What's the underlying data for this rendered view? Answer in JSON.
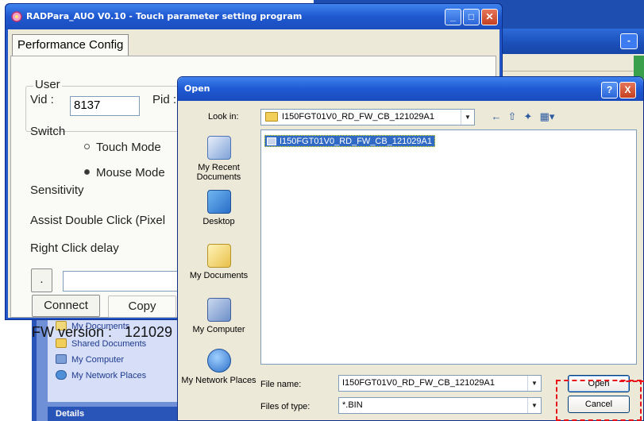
{
  "radpara": {
    "title": "RADPara_AUO V0.10 - Touch parameter setting program",
    "tab": "Performance Config",
    "user_group_label": "User",
    "vid_label": "Vid :",
    "vid_value": "8137",
    "pid_label": "Pid :",
    "switch_label": "Switch",
    "touch_mode": "Touch Mode",
    "mouse_mode": "Mouse Mode",
    "sensitivity_label": "Sensitivity",
    "assist_double_click_label": "Assist Double Click (Pixel",
    "right_click_delay_label": "Right Click delay",
    "small_button": ".",
    "connect_button": "Connect",
    "copy_button": "Copy",
    "fw_version_label": "FW version :",
    "fw_version_value": "121029"
  },
  "background_explorer": {
    "task_items": [
      "My Documents",
      "Shared Documents",
      "My Computer",
      "My Network Places"
    ],
    "details_header": "Details"
  },
  "open_dialog": {
    "title": "Open",
    "help_button": "?",
    "close_button": "X",
    "look_in_label": "Look in:",
    "look_in_value": "I150FGT01V0_RD_FW_CB_121029A1",
    "places": [
      "My Recent Documents",
      "Desktop",
      "My Documents",
      "My Computer",
      "My Network Places"
    ],
    "files": [
      "I150FGT01V0_RD_FW_CB_121029A1"
    ],
    "file_name_label": "File name:",
    "file_name_value": "I150FGT01V0_RD_FW_CB_121029A1",
    "files_of_type_label": "Files of type:",
    "files_of_type_value": "*.BIN",
    "open_button": "Open",
    "cancel_button": "Cancel"
  },
  "colors": {
    "xp_title_blue": "#1f58d0",
    "selection_blue": "#316ac5",
    "annotation_red": "#e8121a"
  }
}
